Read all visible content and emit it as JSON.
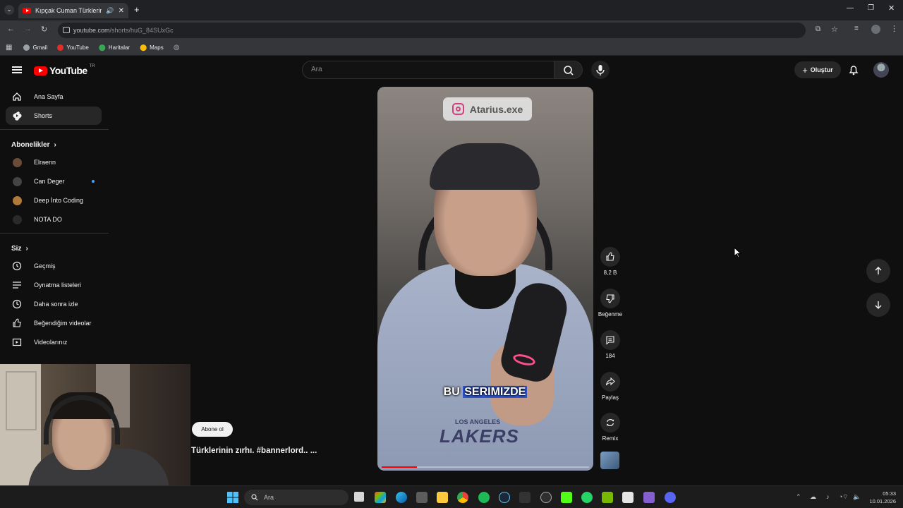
{
  "browser": {
    "tab_title": "Kıpçak Cuman Türklerinin z",
    "url_host": "youtube.com",
    "url_path": "/shorts/huG_84SUxGc",
    "bookmarks": [
      "Gmail",
      "YouTube",
      "Haritalar",
      "Maps"
    ]
  },
  "header": {
    "logo_text": "YouTube",
    "logo_region": "TR",
    "search_placeholder": "Ara",
    "create_label": "Oluştur"
  },
  "sidebar": {
    "main_items": [
      {
        "label": "Ana Sayfa",
        "icon": "home-icon"
      },
      {
        "label": "Shorts",
        "icon": "shorts-icon"
      }
    ],
    "subscriptions_title": "Abonelikler",
    "subscriptions": [
      {
        "label": "Elraenn",
        "color": "#6b4c3b"
      },
      {
        "label": "Can Deger",
        "color": "#444444"
      },
      {
        "label": "Deep İnto Coding",
        "color": "#b07a3a"
      },
      {
        "label": "NOTA DO",
        "color": "#2a2a2a"
      }
    ],
    "you_title": "Siz",
    "you_items": [
      {
        "label": "Geçmiş",
        "icon": "history-icon"
      },
      {
        "label": "Oynatma listeleri",
        "icon": "playlists-icon"
      },
      {
        "label": "Daha sonra izle",
        "icon": "watch-later-icon"
      },
      {
        "label": "Beğendiğim videolar",
        "icon": "liked-videos-icon"
      },
      {
        "label": "Videolarınız",
        "icon": "your-videos-icon"
      }
    ]
  },
  "short": {
    "overlay_tag": "Atarius.exe",
    "caption_plain": "BU",
    "caption_highlight": "SERIMIZDE",
    "shirt_text": "LAKERS",
    "shirt_text_small": "LOS ANGELES",
    "progress_percent": 17,
    "subscribe_label": "Abone ol",
    "title": "Türklerinin zırhı. #bannerlord.. ..."
  },
  "actions": {
    "like_count": "8,2 B",
    "dislike_label": "Beğenme",
    "comment_count": "184",
    "share_label": "Paylaş",
    "remix_label": "Remix"
  },
  "taskbar": {
    "search_placeholder": "Ara",
    "time": "05:33",
    "date": "10.01.2026"
  }
}
